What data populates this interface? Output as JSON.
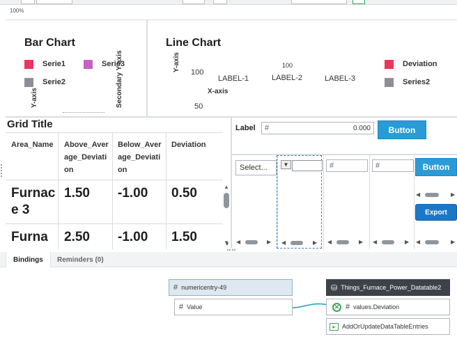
{
  "toolbar": {
    "zoom_label": "100%"
  },
  "bar_chart": {
    "title": "Bar Chart",
    "legend": [
      {
        "label": "Serie1",
        "color": "#e8385a"
      },
      {
        "label": "Serie3",
        "color": "#c561c9"
      },
      {
        "label": "Serie2",
        "color": "#8c9096"
      }
    ],
    "y_axis_label": "Y-axis",
    "secondary_y_axis_label": "Secondary Y-axis"
  },
  "line_chart": {
    "title": "Line Chart",
    "legend": [
      {
        "label": "Deviation",
        "color": "#e8385a"
      },
      {
        "label": "Series2",
        "color": "#8c9096"
      }
    ],
    "y_axis_label": "Y-axis",
    "x_axis_label": "X-axis",
    "tick_top": "100",
    "tick_100": "100",
    "tick_50": "50",
    "x_labels": [
      "LABEL-1",
      "LABEL-2",
      "LABEL-3"
    ]
  },
  "grid": {
    "title": "Grid Title",
    "columns": [
      "Area_Name",
      "Above_Average_Deviation",
      "Below_Average_Deviation",
      "Deviation"
    ],
    "rows": [
      {
        "area": "Furnace 3",
        "above": "1.50",
        "below": "-1.00",
        "deviation": "0.50"
      },
      {
        "area": "Furna",
        "above": "2.50",
        "below": "-1.00",
        "deviation": "1.50"
      }
    ]
  },
  "form": {
    "label": "Label",
    "numeric_value": "0.000",
    "button_label": "Button",
    "select_placeholder": "Select...",
    "button2_label": "Button",
    "export_label": "Export"
  },
  "bottom_panel": {
    "tabs": [
      {
        "label": "Bindings",
        "active": true
      },
      {
        "label": "Reminders (0)",
        "active": false
      }
    ],
    "source_node": "numericentry-49",
    "source_property": "Value",
    "target_node": "Things_Furnace_Power_Datatable2",
    "target_property": "values.Deviation",
    "target_service": "AddOrUpdateDataTableEntries"
  }
}
